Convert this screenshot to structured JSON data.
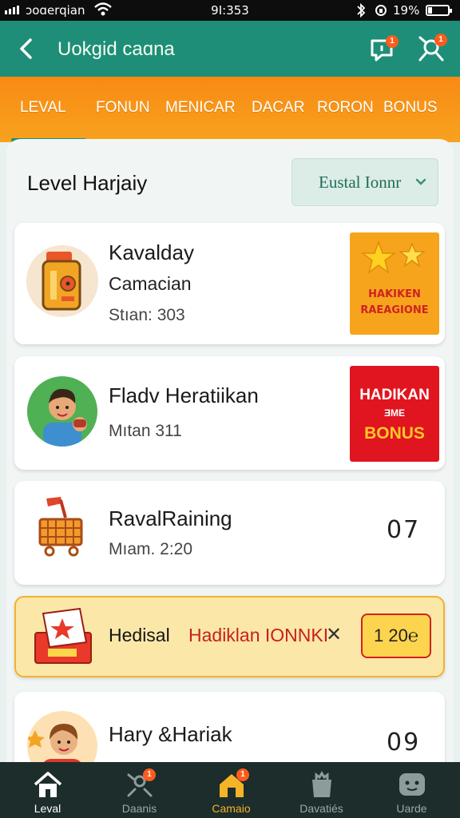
{
  "status_bar": {
    "carrier": "ɔoɑerqian",
    "time": "9Ι:353",
    "battery": "19%",
    "battery_level": 0.19
  },
  "app_bar": {
    "title": "Uokgid caɑna",
    "notification_badge": "1",
    "profile_badge": "1"
  },
  "tabs": [
    {
      "label": "LEVAL",
      "active": true
    },
    {
      "label": "FONUN"
    },
    {
      "label": "MENICAR"
    },
    {
      "label": "DACAR"
    },
    {
      "label": "RORON"
    },
    {
      "label": "BONUS"
    }
  ],
  "section": {
    "heading": "Level Harjaiy",
    "filter_value": "Eustal Ionnr"
  },
  "cards": [
    {
      "title": "Kavalday",
      "subtitle": "Camacian",
      "meta": "Stıan: 303",
      "promo_text": [
        "HAKIKEN",
        "RAEAGIONE"
      ],
      "avatar_icon": "jar-icon",
      "promo_icon": "stars-icon"
    },
    {
      "title": "Fladv Heratiikan",
      "meta": "Mıtan 311",
      "promo": {
        "line1": "HADIKAN",
        "line2": "ƎME",
        "line3": "BONUS"
      },
      "avatar_icon": "boy-avatar-icon"
    },
    {
      "title": "RavalRaining",
      "meta": "Mıam. 2:20",
      "score": "07",
      "avatar_icon": "shopping-cart-icon"
    },
    {
      "title": "Hary &Hariak",
      "score": "09",
      "avatar_icon": "girl-avatar-icon"
    }
  ],
  "highlight": {
    "label1": "Hedisal",
    "label2": "Hadiklan IONNKI",
    "close": "✕",
    "value": "1 20℮",
    "icon": "gift-box-icon"
  },
  "bottom_nav": [
    {
      "label": "Leval",
      "icon": "home-icon",
      "active": true
    },
    {
      "label": "Daanis",
      "icon": "people-icon",
      "badge": "1"
    },
    {
      "label": "Camaio",
      "icon": "house-icon",
      "badge": "1"
    },
    {
      "label": "Davatiés",
      "icon": "bag-icon"
    },
    {
      "label": "Uarde",
      "icon": "chat-face-icon"
    }
  ],
  "colors": {
    "primary": "#1e8e78",
    "accent": "#f98a14",
    "promo_red": "#e1151f",
    "promo_orange": "#f7a41d",
    "highlight_bg": "#fbe8a9",
    "nav_bg": "#1c2d2c"
  }
}
